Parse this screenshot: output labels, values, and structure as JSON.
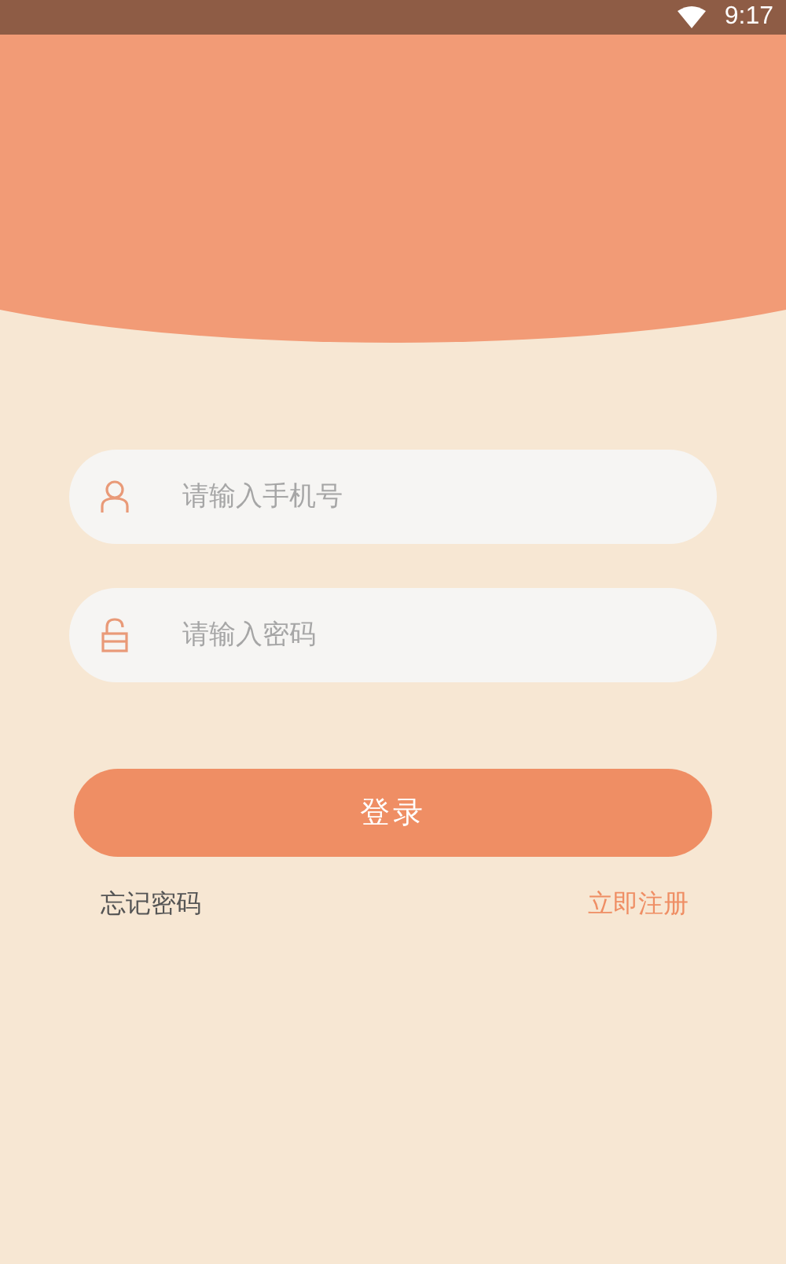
{
  "status_bar": {
    "time": "9:17"
  },
  "fields": [
    {
      "kind": "user",
      "placeholder": "请输入手机号"
    },
    {
      "kind": "lock",
      "placeholder": "请输入密码"
    }
  ],
  "login_button": "登录",
  "links": {
    "forgot_password": "忘记密码",
    "register": "立即注册"
  }
}
